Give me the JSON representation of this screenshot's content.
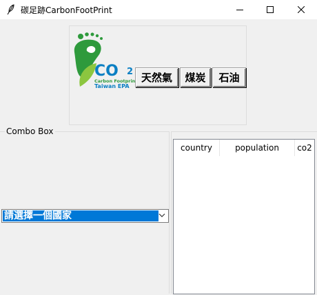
{
  "window": {
    "title": "碳足跡CarbonFootPrint",
    "minimize_icon": "minimize-icon",
    "maximize_icon": "maximize-icon",
    "close_icon": "close-icon"
  },
  "logo": {
    "text_co": "CO",
    "text_sub": "2",
    "line1": "Carbon Footprint",
    "line2": "Taiwan EPA",
    "colors": {
      "green": "#2e9a3c",
      "lightgreen": "#8cc63f",
      "blue": "#0a7fc3"
    }
  },
  "buttons": {
    "natural_gas": "天然氣",
    "coal": "煤炭",
    "oil": "石油"
  },
  "combo_group": {
    "label": "Combo Box",
    "combo_value": "請選擇一個國家"
  },
  "table": {
    "columns": [
      "country",
      "population",
      "co2"
    ],
    "rows": []
  },
  "colors": {
    "selection": "#0078d7",
    "window_bg": "#f0f0f0"
  }
}
